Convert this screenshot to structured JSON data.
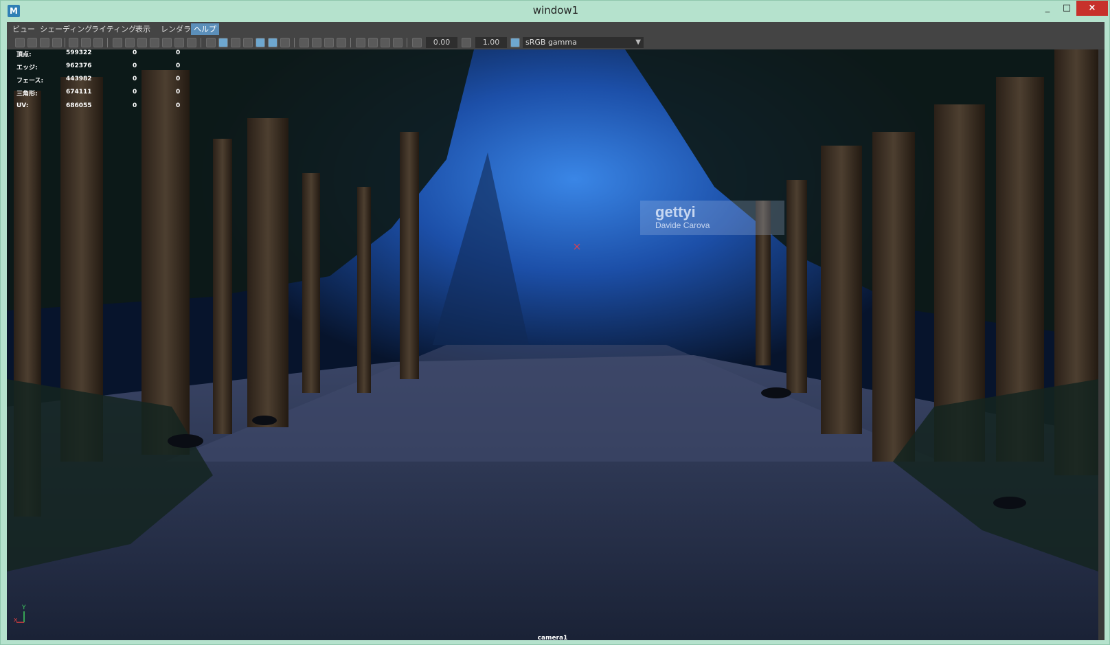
{
  "window": {
    "title": "window1",
    "app_icon": "M",
    "minimize": "_",
    "maximize": "□",
    "close": "×"
  },
  "menu": [
    {
      "label": "ビュー"
    },
    {
      "label": "シェーディング"
    },
    {
      "label": "ライティング"
    },
    {
      "label": "表示"
    },
    {
      "label": "レンダラ"
    },
    {
      "label": "ヘルプ",
      "active": true
    }
  ],
  "toolbar": {
    "exposure": "0.00",
    "gamma_value": "1.00",
    "color_space": "sRGB gamma"
  },
  "hud": {
    "rows": [
      {
        "label": "頂点:",
        "v1": "599322",
        "v2": "0",
        "v3": "0"
      },
      {
        "label": "エッジ:",
        "v1": "962376",
        "v2": "0",
        "v3": "0"
      },
      {
        "label": "フェース:",
        "v1": "443982",
        "v2": "0",
        "v3": "0"
      },
      {
        "label": "三角形:",
        "v1": "674111",
        "v2": "0",
        "v3": "0"
      },
      {
        "label": "UV:",
        "v1": "686055",
        "v2": "0",
        "v3": "0"
      }
    ]
  },
  "viewport": {
    "camera": "camera1",
    "watermark_title": "gettyi",
    "watermark_credit": "Davide Carova",
    "axis_y": "Y",
    "axis_x": "x"
  },
  "colors": {
    "accent": "#5b8fba",
    "close": "#c7312b",
    "frame": "#b5e2cd"
  }
}
